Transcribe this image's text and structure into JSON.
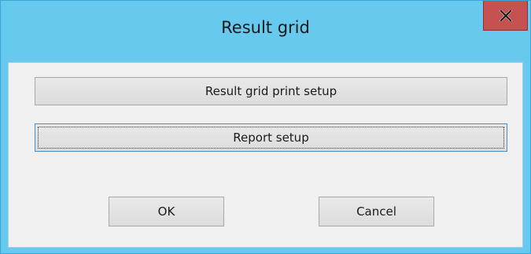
{
  "window": {
    "title": "Result grid",
    "close_icon": "close-icon",
    "close_color": "#c75050",
    "title_bar_color": "#67c9ee"
  },
  "buttons": {
    "print_setup": "Result grid print setup",
    "report_setup": "Report setup",
    "ok": "OK",
    "cancel": "Cancel"
  }
}
